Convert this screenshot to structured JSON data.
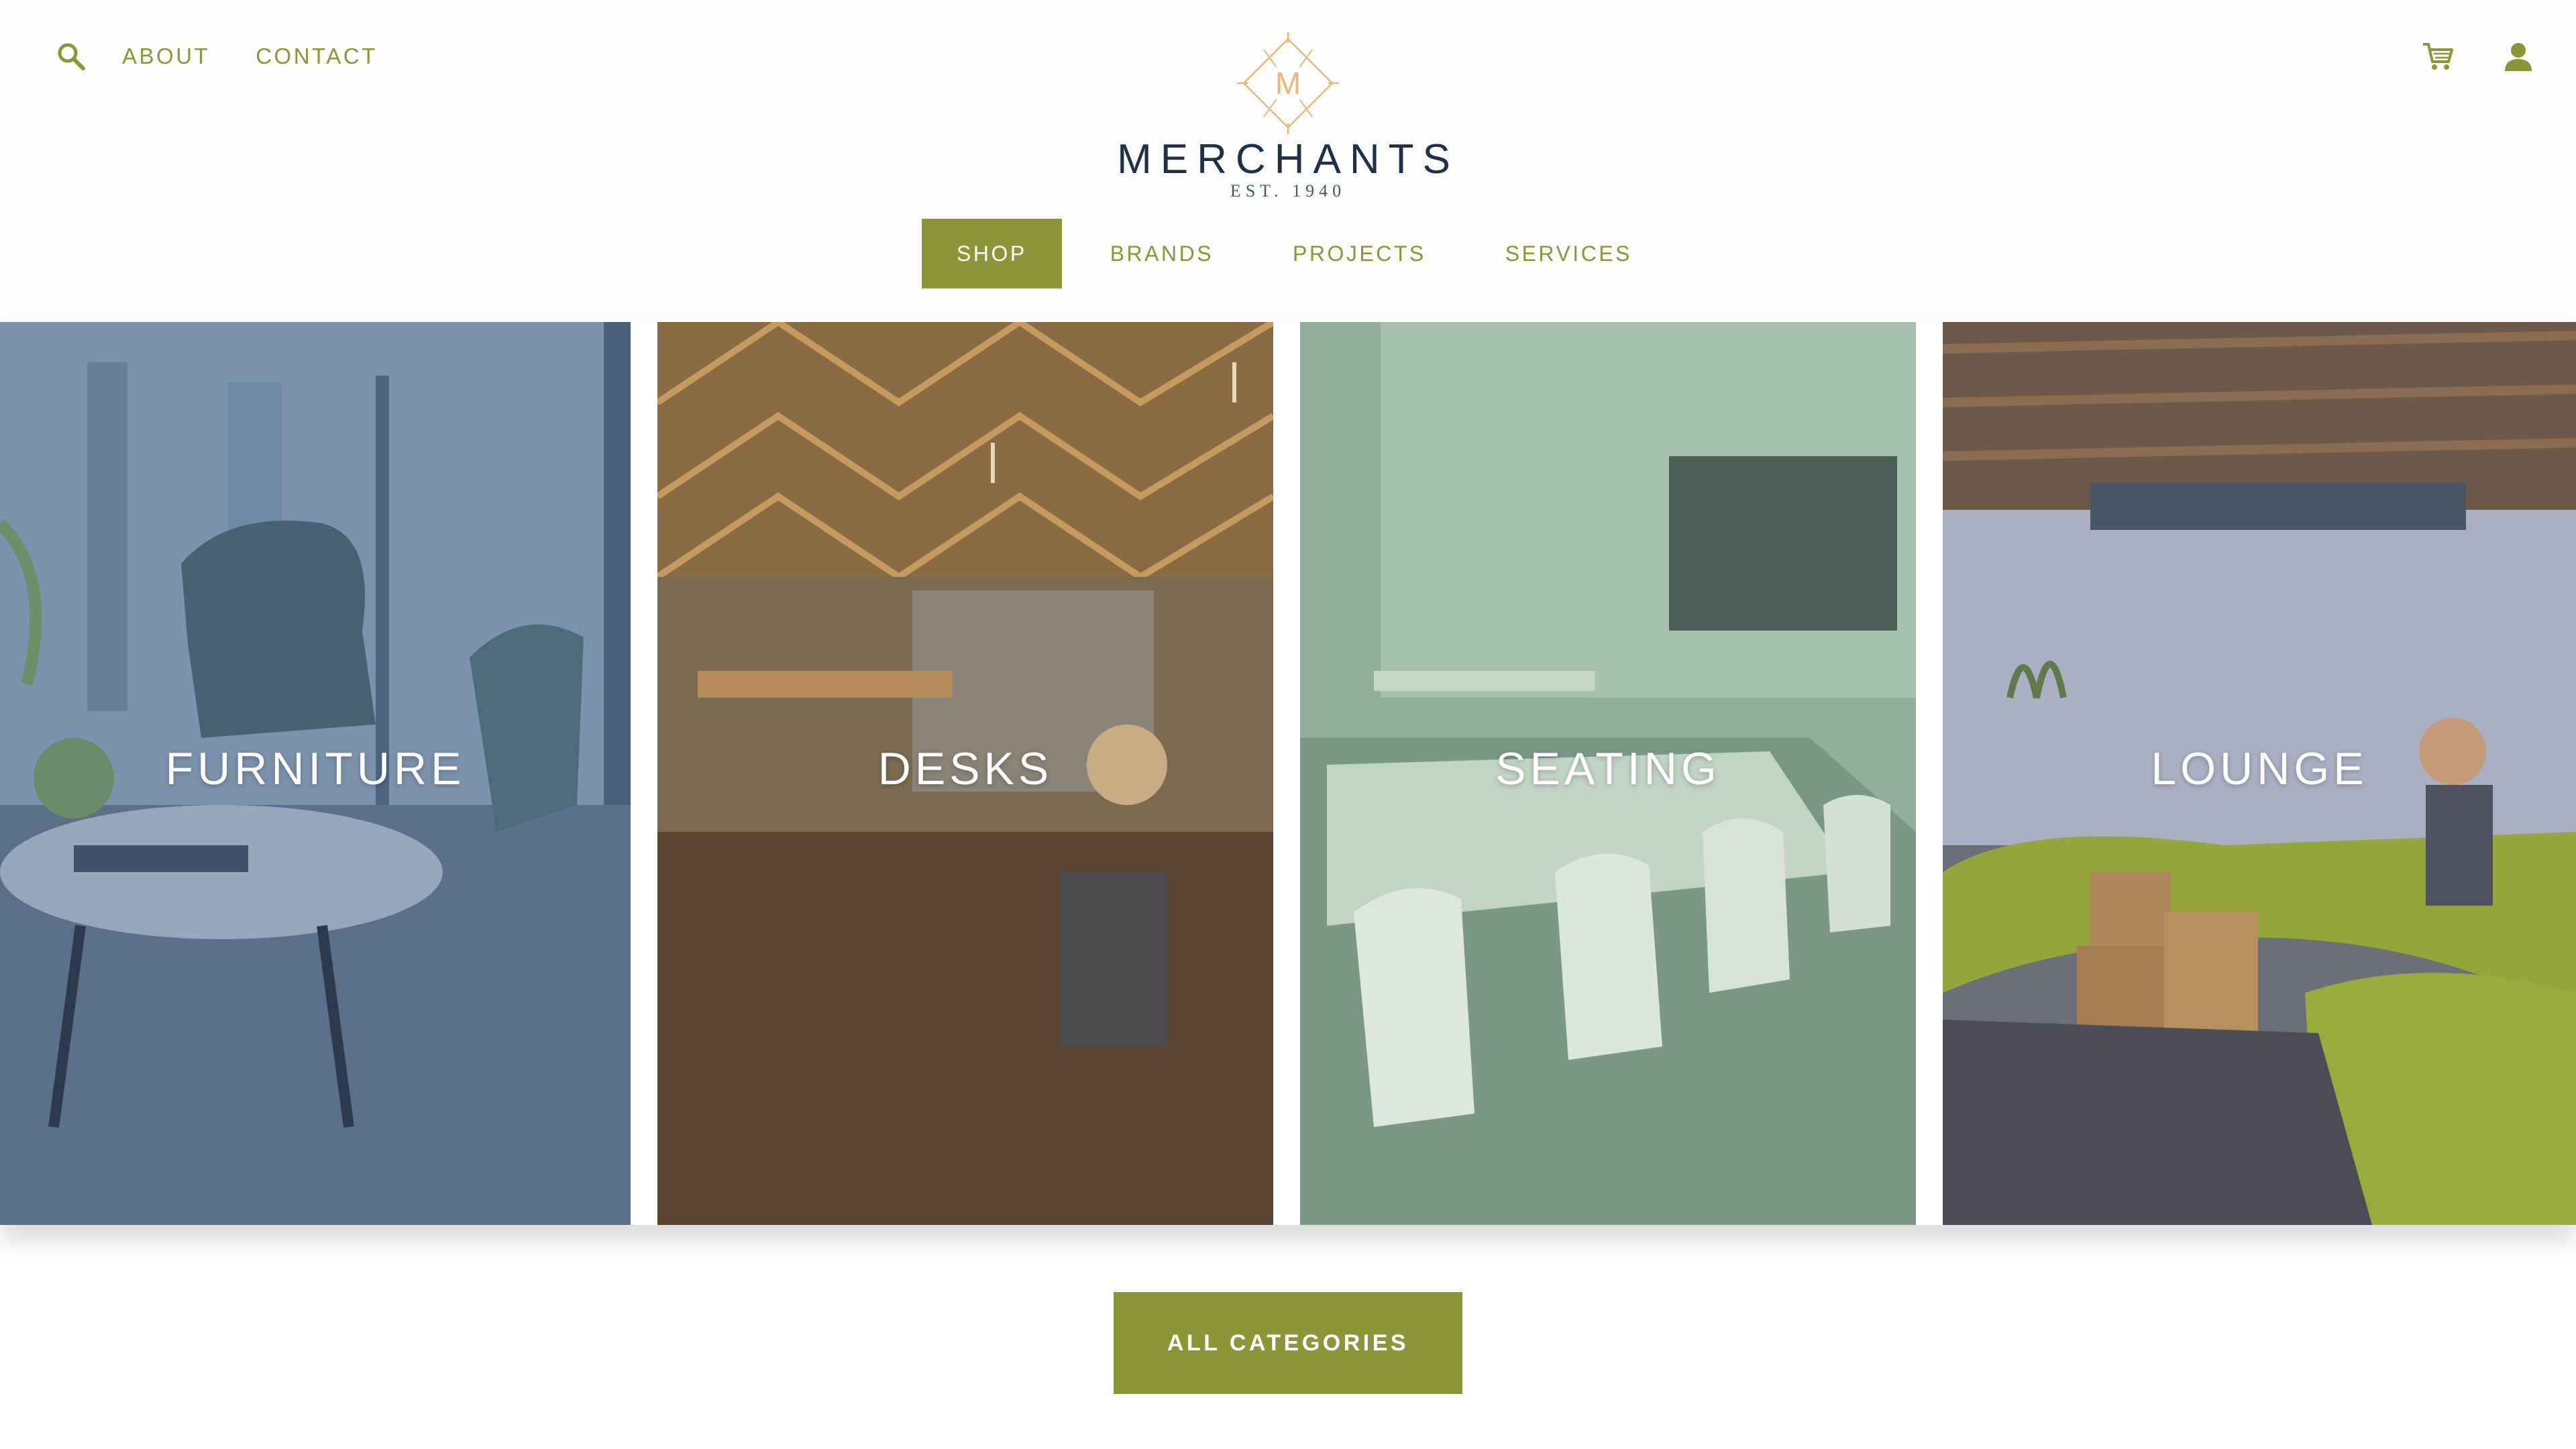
{
  "header": {
    "utility_left": [
      {
        "label": "ABOUT"
      },
      {
        "label": "CONTACT"
      }
    ],
    "icons": {
      "search": "search-icon",
      "cart": "cart-icon",
      "user": "user-icon"
    },
    "logo": {
      "monogram": "M",
      "name": "MERCHANTS",
      "tagline": "EST. 1940"
    }
  },
  "nav": {
    "items": [
      {
        "label": "SHOP",
        "active": true
      },
      {
        "label": "BRANDS",
        "active": false
      },
      {
        "label": "PROJECTS",
        "active": false
      },
      {
        "label": "SERVICES",
        "active": false
      }
    ]
  },
  "categories": [
    {
      "label": "FURNITURE"
    },
    {
      "label": "DESKS"
    },
    {
      "label": "SEATING"
    },
    {
      "label": "LOUNGE"
    }
  ],
  "cta": {
    "label": "ALL CATEGORIES"
  },
  "colors": {
    "accent": "#8b9638",
    "brand_text": "#1f3148",
    "logo_mark": "#e8b879"
  }
}
